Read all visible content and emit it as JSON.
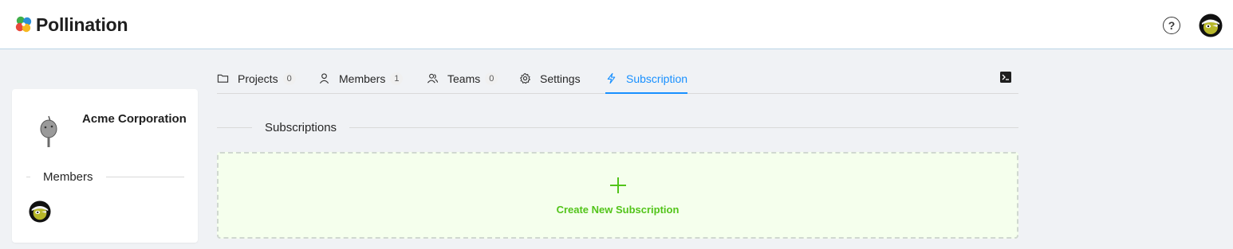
{
  "header": {
    "brand": "Pollination",
    "help_symbol": "?",
    "help_icon": "question-circle-icon",
    "avatar_icon": "user-avatar-icon"
  },
  "org": {
    "name": "Acme Corporation",
    "logo_icon": "org-logo-icon",
    "members_title": "Members",
    "members": [
      {
        "avatar_icon": "member-avatar-icon"
      }
    ]
  },
  "tabs": [
    {
      "label": "Projects",
      "count": "0",
      "icon": "folder-icon",
      "active": false
    },
    {
      "label": "Members",
      "count": "1",
      "icon": "user-icon",
      "active": false
    },
    {
      "label": "Teams",
      "count": "0",
      "icon": "team-icon",
      "active": false
    },
    {
      "label": "Settings",
      "icon": "gear-icon",
      "active": false
    },
    {
      "label": "Subscription",
      "icon": "lightning-icon",
      "active": true
    }
  ],
  "toolbar": {
    "terminal_icon": "terminal-icon"
  },
  "subscriptions": {
    "title": "Subscriptions",
    "create_label": "Create New Subscription",
    "create_icon": "plus-icon"
  },
  "colors": {
    "accent": "#1890ff",
    "success": "#52c41a",
    "background": "#f0f2f5",
    "create_box_bg": "#f5ffed"
  }
}
